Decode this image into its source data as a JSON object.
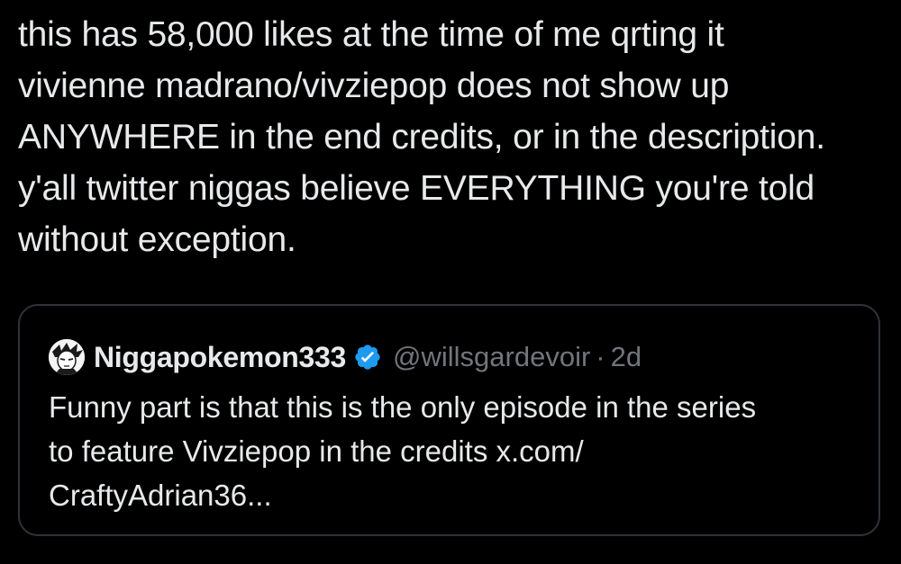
{
  "tweet": {
    "lines": [
      "this has 58,000 likes at the time of me qrting it",
      "vivienne madrano/vivziepop does not show up",
      "ANYWHERE in the end credits, or in the description.",
      "y'all twitter niggas believe EVERYTHING you're told",
      "without exception."
    ]
  },
  "quote": {
    "avatar_icon": "anime-character-avatar-icon",
    "display_name": "Niggapokemon333",
    "verified_icon": "verified-badge-icon",
    "verified_color": "#1d9bf0",
    "handle": "@willsgardevoir",
    "separator": "·",
    "age": "2d",
    "lines": [
      "Funny part is that this is the only episode in the series",
      "to feature Vivziepop in the credits x.com/",
      "CraftyAdrian36..."
    ]
  },
  "colors": {
    "background": "#000000",
    "text": "#e7e9ea",
    "secondary_text": "#71767b",
    "border": "#2f3336"
  }
}
